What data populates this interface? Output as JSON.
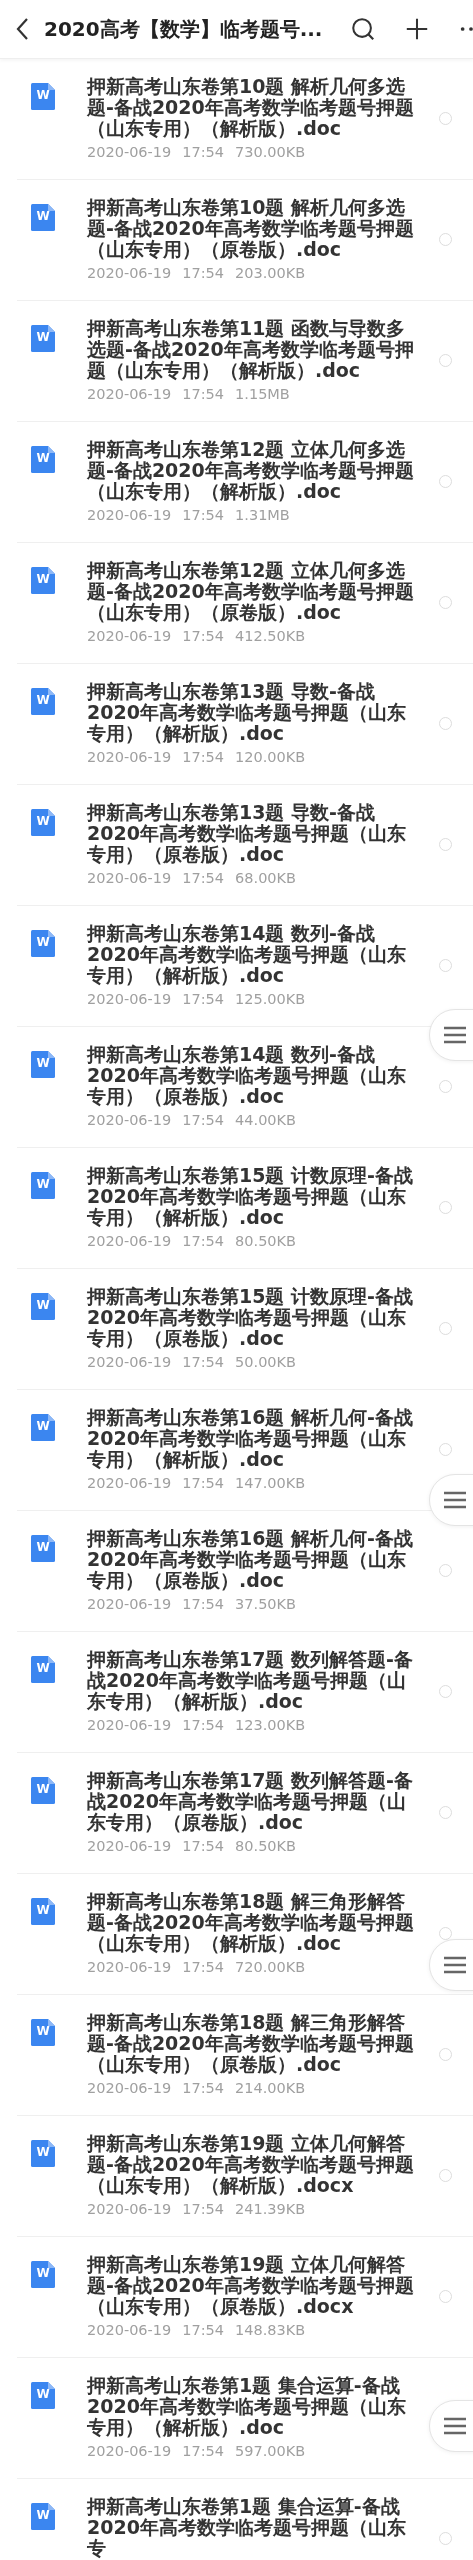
{
  "header": {
    "title": "2020高考【数学】临考题号..."
  },
  "files": [
    {
      "icon": "W",
      "title": "押新高考山东卷第10题 解析几何多选题-备战2020年高考数学临考题号押题（山东专用）（解析版）.doc",
      "date": "2020-06-19",
      "time": "17:54",
      "size": "730.00KB",
      "selected": false
    },
    {
      "icon": "W",
      "title": "押新高考山东卷第10题 解析几何多选题-备战2020年高考数学临考题号押题（山东专用）（原卷版）.doc",
      "date": "2020-06-19",
      "time": "17:54",
      "size": "203.00KB",
      "selected": false
    },
    {
      "icon": "W",
      "title": "押新高考山东卷第11题 函数与导数多选题-备战2020年高考数学临考题号押题（山东专用）（解析版）.doc",
      "date": "2020-06-19",
      "time": "17:54",
      "size": "1.15MB",
      "selected": false
    },
    {
      "icon": "W",
      "title": "押新高考山东卷第12题 立体几何多选题-备战2020年高考数学临考题号押题（山东专用）（解析版）.doc",
      "date": "2020-06-19",
      "time": "17:54",
      "size": "1.31MB",
      "selected": false
    },
    {
      "icon": "W",
      "title": "押新高考山东卷第12题 立体几何多选题-备战2020年高考数学临考题号押题（山东专用）（原卷版）.doc",
      "date": "2020-06-19",
      "time": "17:54",
      "size": "412.50KB",
      "selected": false
    },
    {
      "icon": "W",
      "title": "押新高考山东卷第13题 导数-备战2020年高考数学临考题号押题（山东专用）（解析版）.doc",
      "date": "2020-06-19",
      "time": "17:54",
      "size": "120.00KB",
      "selected": false
    },
    {
      "icon": "W",
      "title": "押新高考山东卷第13题 导数-备战2020年高考数学临考题号押题（山东专用）（原卷版）.doc",
      "date": "2020-06-19",
      "time": "17:54",
      "size": "68.00KB",
      "selected": false
    },
    {
      "icon": "W",
      "title": "押新高考山东卷第14题 数列-备战2020年高考数学临考题号押题（山东专用）（解析版）.doc",
      "date": "2020-06-19",
      "time": "17:54",
      "size": "125.00KB",
      "selected": false
    },
    {
      "icon": "W",
      "title": "押新高考山东卷第14题 数列-备战2020年高考数学临考题号押题（山东专用）（原卷版）.doc",
      "date": "2020-06-19",
      "time": "17:54",
      "size": "44.00KB",
      "selected": false
    },
    {
      "icon": "W",
      "title": "押新高考山东卷第15题 计数原理-备战2020年高考数学临考题号押题（山东专用）（解析版）.doc",
      "date": "2020-06-19",
      "time": "17:54",
      "size": "80.50KB",
      "selected": false
    },
    {
      "icon": "W",
      "title": "押新高考山东卷第15题 计数原理-备战2020年高考数学临考题号押题（山东专用）（原卷版）.doc",
      "date": "2020-06-19",
      "time": "17:54",
      "size": "50.00KB",
      "selected": false
    },
    {
      "icon": "W",
      "title": "押新高考山东卷第16题 解析几何-备战2020年高考数学临考题号押题（山东专用）（解析版）.doc",
      "date": "2020-06-19",
      "time": "17:54",
      "size": "147.00KB",
      "selected": false
    },
    {
      "icon": "W",
      "title": "押新高考山东卷第16题 解析几何-备战2020年高考数学临考题号押题（山东专用）（原卷版）.doc",
      "date": "2020-06-19",
      "time": "17:54",
      "size": "37.50KB",
      "selected": false
    },
    {
      "icon": "W",
      "title": "押新高考山东卷第17题 数列解答题-备战2020年高考数学临考题号押题（山东专用）（解析版）.doc",
      "date": "2020-06-19",
      "time": "17:54",
      "size": "123.00KB",
      "selected": false
    },
    {
      "icon": "W",
      "title": "押新高考山东卷第17题 数列解答题-备战2020年高考数学临考题号押题（山东专用）（原卷版）.doc",
      "date": "2020-06-19",
      "time": "17:54",
      "size": "80.50KB",
      "selected": false
    },
    {
      "icon": "W",
      "title": "押新高考山东卷第18题 解三角形解答题-备战2020年高考数学临考题号押题（山东专用）（解析版）.doc",
      "date": "2020-06-19",
      "time": "17:54",
      "size": "720.00KB",
      "selected": false
    },
    {
      "icon": "W",
      "title": "押新高考山东卷第18题 解三角形解答题-备战2020年高考数学临考题号押题（山东专用）（原卷版）.doc",
      "date": "2020-06-19",
      "time": "17:54",
      "size": "214.00KB",
      "selected": false
    },
    {
      "icon": "W",
      "title": "押新高考山东卷第19题 立体几何解答题-备战2020年高考数学临考题号押题（山东专用）（解析版）.docx",
      "date": "2020-06-19",
      "time": "17:54",
      "size": "241.39KB",
      "selected": false
    },
    {
      "icon": "W",
      "title": "押新高考山东卷第19题 立体几何解答题-备战2020年高考数学临考题号押题（山东专用）（原卷版）.docx",
      "date": "2020-06-19",
      "time": "17:54",
      "size": "148.83KB",
      "selected": false
    },
    {
      "icon": "W",
      "title": "押新高考山东卷第1题 集合运算-备战2020年高考数学临考题号押题（山东专用）（解析版）.doc",
      "date": "2020-06-19",
      "time": "17:54",
      "size": "597.00KB"
    },
    {
      "icon": "W",
      "title": "押新高考山东卷第1题 集合运算-备战2020年高考数学临考题号押题（山东专",
      "selected": false
    }
  ]
}
